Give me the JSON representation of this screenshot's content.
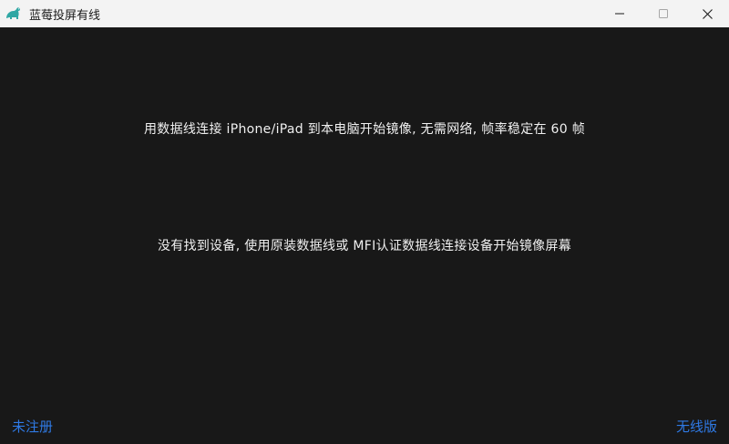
{
  "window": {
    "title": "蓝莓投屏有线",
    "icon": "blueberry-dino-icon",
    "controls": [
      "minimize-icon",
      "maximize-icon",
      "close-icon"
    ]
  },
  "main": {
    "usb_description": "用数据线连接 iPhone/iPad 到本电脑开始镜像, 无需网络, 帧率稳定在 60 帧",
    "status_message": "没有找到设备, 使用原装数据线或 MFI认证数据线连接设备开始镜像屏幕"
  },
  "footer": {
    "register_label": "未注册",
    "wireless_label": "无线版"
  },
  "colors": {
    "background": "#181818",
    "titlebar": "#f3f3f3",
    "link": "#2f7ae5",
    "text": "#f0f0f0",
    "icon": "#2fa7a4"
  }
}
